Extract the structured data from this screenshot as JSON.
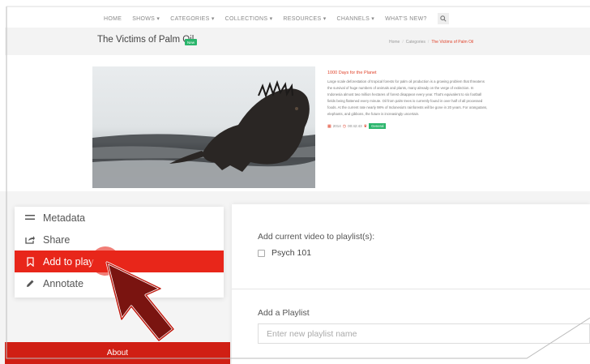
{
  "nav": {
    "items": [
      "HOME",
      "SHOWS ▾",
      "CATEGORIES ▾",
      "COLLECTIONS ▾",
      "RESOURCES ▾",
      "CHANNELS ▾",
      "WHAT'S NEW?"
    ],
    "search_icon": "search-icon"
  },
  "header": {
    "title": "The Victims of Palm Oil",
    "badge": "New",
    "breadcrumb": [
      "Home",
      "Categories",
      "The Victims of Palm Oil"
    ]
  },
  "video": {
    "image_subject": "marine iguana on rocky shore",
    "desc_title": "1000 Days for the Planet",
    "desc_body": "Large scale deforestation of tropical forests for palm oil production is a growing problem that threatens the survival of huge numbers of animals and plants, many already on the verge of extinction. In Indonesia almost two million hectares of forest disappear every year. That's equivalent to six football fields being flattened every minute. Oil from palm trees is currently found in over half of all processed foods. At the current rate nearly 98% of Indonesia's rainforests will be gone in 20 years. For orangutans, elephants, and gibbons, the future is increasingly uncertain.",
    "year": "2014",
    "duration": "00:42:43",
    "genre": "General"
  },
  "menu": {
    "items": [
      {
        "label": "Metadata",
        "icon": "list-icon"
      },
      {
        "label": "Share",
        "icon": "share-icon"
      },
      {
        "label": "Add to play",
        "icon": "bookmark-icon"
      },
      {
        "label": "Annotate",
        "icon": "pencil-icon"
      }
    ],
    "active_index": 2,
    "about": "About"
  },
  "playlist": {
    "heading": "Add current video to playlist(s):",
    "options": [
      {
        "label": "Psych 101",
        "checked": false
      }
    ],
    "add_label": "Add a Playlist",
    "placeholder": "Enter new playlist name"
  },
  "colors": {
    "accent": "#e8261a",
    "badge_green": "#2ab56b",
    "link_red": "#e0442c"
  }
}
